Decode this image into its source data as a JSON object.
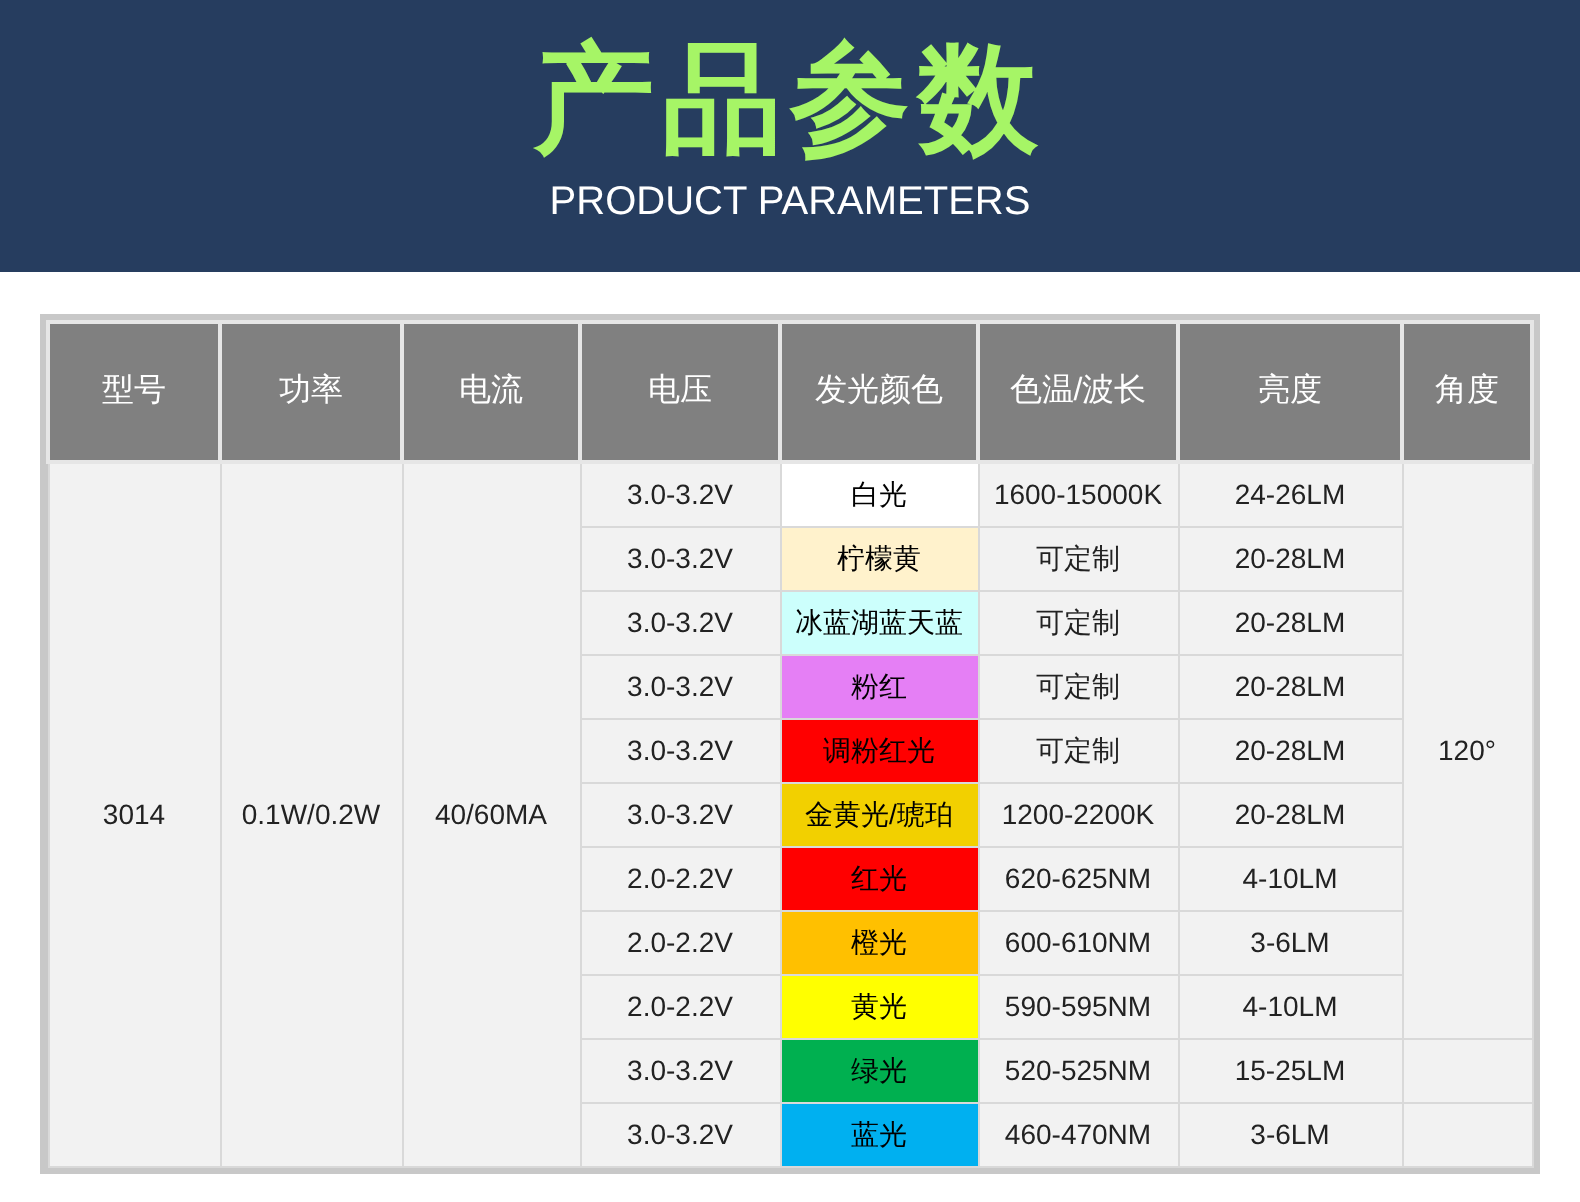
{
  "header": {
    "title": "产品参数",
    "subtitle": "PRODUCT PARAMETERS"
  },
  "table": {
    "columns": [
      "型号",
      "功率",
      "电流",
      "电压",
      "发光颜色",
      "色温/波长",
      "亮度",
      "角度"
    ],
    "model": "3014",
    "power": "0.1W/0.2W",
    "current": "40/60MA",
    "angle": "120°",
    "rows": [
      {
        "voltage": "3.0-3.2V",
        "color_name": "白光",
        "color": "#ffffff",
        "wavelength": "1600-15000K",
        "brightness": "24-26LM"
      },
      {
        "voltage": "3.0-3.2V",
        "color_name": "柠檬黄",
        "color": "#fff2cc",
        "wavelength": "可定制",
        "brightness": "20-28LM"
      },
      {
        "voltage": "3.0-3.2V",
        "color_name": "冰蓝湖蓝天蓝",
        "color": "#ccfffc",
        "wavelength": "可定制",
        "brightness": "20-28LM"
      },
      {
        "voltage": "3.0-3.2V",
        "color_name": "粉红",
        "color": "#e57ff5",
        "wavelength": "可定制",
        "brightness": "20-28LM"
      },
      {
        "voltage": "3.0-3.2V",
        "color_name": "调粉红光",
        "color": "#ff0000",
        "wavelength": "可定制",
        "brightness": "20-28LM"
      },
      {
        "voltage": "3.0-3.2V",
        "color_name": "金黄光/琥珀",
        "color": "#f2d000",
        "wavelength": "1200-2200K",
        "brightness": "20-28LM"
      },
      {
        "voltage": "2.0-2.2V",
        "color_name": "红光",
        "color": "#ff0000",
        "wavelength": "620-625NM",
        "brightness": "4-10LM"
      },
      {
        "voltage": "2.0-2.2V",
        "color_name": "橙光",
        "color": "#ffc000",
        "wavelength": "600-610NM",
        "brightness": "3-6LM"
      },
      {
        "voltage": "2.0-2.2V",
        "color_name": "黄光",
        "color": "#ffff00",
        "wavelength": "590-595NM",
        "brightness": "4-10LM"
      },
      {
        "voltage": "3.0-3.2V",
        "color_name": "绿光",
        "color": "#00b050",
        "wavelength": "520-525NM",
        "brightness": "15-25LM"
      },
      {
        "voltage": "3.0-3.2V",
        "color_name": "蓝光",
        "color": "#00b0f0",
        "wavelength": "460-470NM",
        "brightness": "3-6LM"
      }
    ]
  }
}
